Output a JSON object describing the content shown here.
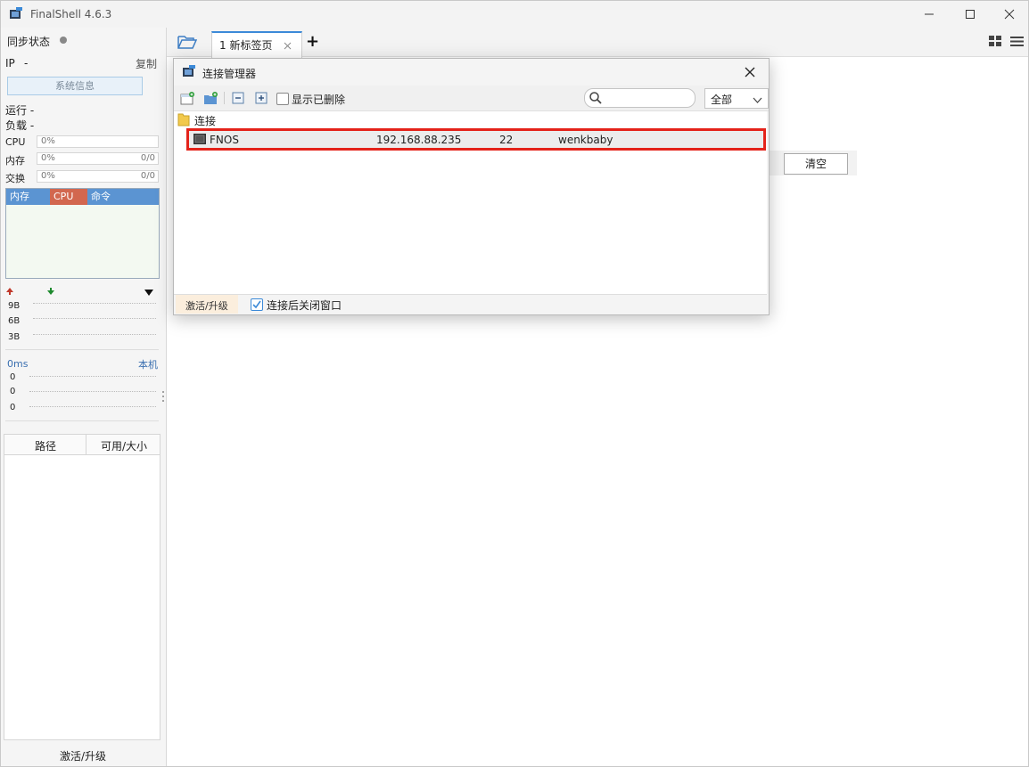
{
  "app": {
    "title": "FinalShell 4.6.3"
  },
  "window_controls": {
    "minimize": "—",
    "maximize": "☐",
    "close": "✕"
  },
  "left": {
    "sync_label": "同步状态",
    "ip_label": "IP",
    "ip_value": "-",
    "copy_label": "复制",
    "sysinfo_button": "系统信息",
    "run_label": "运行 -",
    "load_label": "负载 -",
    "cpu": {
      "label": "CPU",
      "pct": "0%",
      "level": 0
    },
    "mem": {
      "label": "内存",
      "pct": "0%",
      "value": "0/0",
      "level": 0
    },
    "swap": {
      "label": "交换",
      "pct": "0%",
      "value": "0/0",
      "level": 0
    },
    "graph_tabs": [
      "内存",
      "CPU",
      "命令"
    ],
    "net_scale": [
      "9B",
      "6B",
      "3B"
    ],
    "ping": {
      "ms": "0ms",
      "local": "本机",
      "values": [
        "0",
        "0",
        "0"
      ]
    },
    "path_table": {
      "col_path": "路径",
      "col_size": "可用/大小"
    },
    "activate": "激活/升级"
  },
  "tabbar": {
    "tab_label": "1 新标签页",
    "add": "+"
  },
  "dialog": {
    "title": "连接管理器",
    "show_deleted": "显示已删除",
    "filter": "全部",
    "folder": "连接",
    "connection": {
      "name": "FNOS",
      "host": "192.168.88.235",
      "port": "22",
      "user": "wenkbaby"
    },
    "activate": "激活/升级",
    "close_after_connect": "连接后关闭窗口"
  },
  "main": {
    "clear_button": "清空"
  },
  "colors": {
    "accent": "#3c8ad8",
    "highlight": "#e4231a",
    "mem_tab": "#5b94d2",
    "cpu_tab": "#d2674f"
  }
}
